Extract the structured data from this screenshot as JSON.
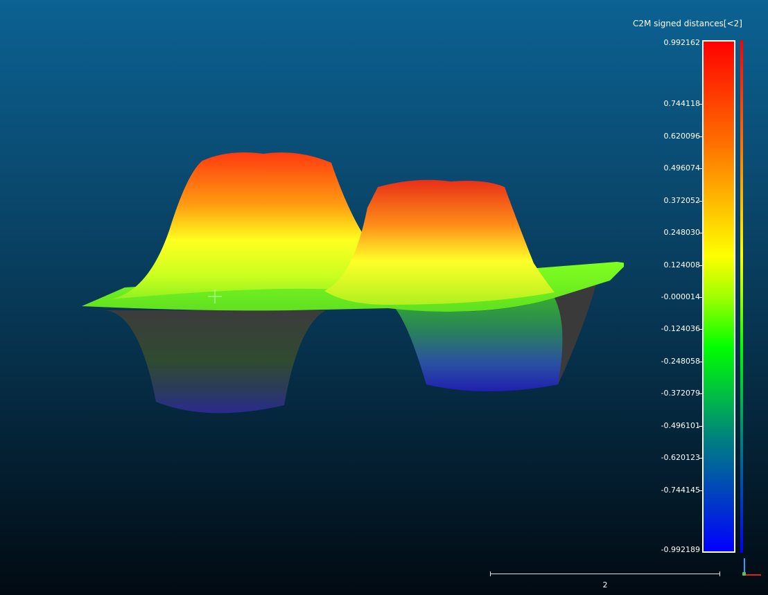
{
  "scalar_field": {
    "title": "C2M signed distances[<2]",
    "colors": {
      "top": "#ff0000",
      "mid": "#ffff00",
      "zero": "#80ff00",
      "bottom": "#0000ff"
    },
    "ticks": [
      {
        "label": "0.992162"
      },
      {
        "label": "0.744118"
      },
      {
        "label": "0.620096"
      },
      {
        "label": "0.496074"
      },
      {
        "label": "0.372052"
      },
      {
        "label": "0.248030"
      },
      {
        "label": "0.124008"
      },
      {
        "label": "-0.000014"
      },
      {
        "label": "-0.124036"
      },
      {
        "label": "-0.248058"
      },
      {
        "label": "-0.372079"
      },
      {
        "label": "-0.496101"
      },
      {
        "label": "-0.620123"
      },
      {
        "label": "-0.744145"
      },
      {
        "label": "-0.992189"
      }
    ]
  },
  "scale_bar": {
    "label": "2"
  },
  "axes": {
    "x_color": "#e02020",
    "y_color": "#2aa0ff",
    "z_color": "#60c060"
  },
  "icons": {
    "cursor": "crosshair-icon"
  }
}
